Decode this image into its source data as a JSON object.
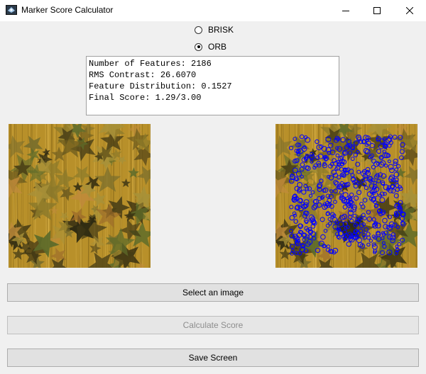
{
  "window": {
    "title": "Marker Score Calculator",
    "controls": [
      "minimize-icon",
      "maximize-icon",
      "close-icon"
    ]
  },
  "detector": {
    "options": [
      {
        "label": "BRISK",
        "checked": false
      },
      {
        "label": "ORB",
        "checked": true
      }
    ]
  },
  "results": {
    "lines": [
      "Number of Features: 2186",
      "RMS Contrast: 26.6070",
      "Feature Distribution: 0.1527",
      "Final Score: 1.29/3.00"
    ]
  },
  "images": {
    "original": {
      "icon": "leaf-texture-image"
    },
    "keypoints": {
      "icon": "leaf-texture-keypoints-image",
      "marker_color": "#0000ff"
    }
  },
  "buttons": {
    "select": {
      "label": "Select an image",
      "enabled": true
    },
    "calculate": {
      "label": "Calculate Score",
      "enabled": false
    },
    "save": {
      "label": "Save Screen",
      "enabled": true
    }
  }
}
